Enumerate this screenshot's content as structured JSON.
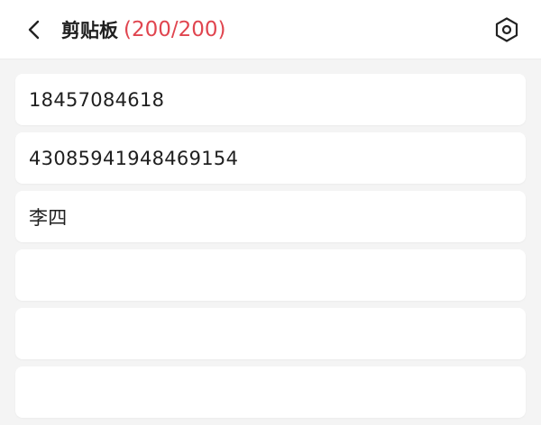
{
  "header": {
    "title": "剪贴板",
    "count": "(200/200)",
    "back_icon": "chevron-left-icon",
    "settings_icon": "hexagon-settings-icon"
  },
  "colors": {
    "count": "#e0454f",
    "background": "#f4f4f4",
    "card": "#ffffff"
  },
  "clipboard": {
    "items": [
      {
        "text": "18457084618"
      },
      {
        "text": "43085941948469154"
      },
      {
        "text": "李四"
      },
      {
        "text": ""
      },
      {
        "text": ""
      },
      {
        "text": ""
      }
    ]
  }
}
